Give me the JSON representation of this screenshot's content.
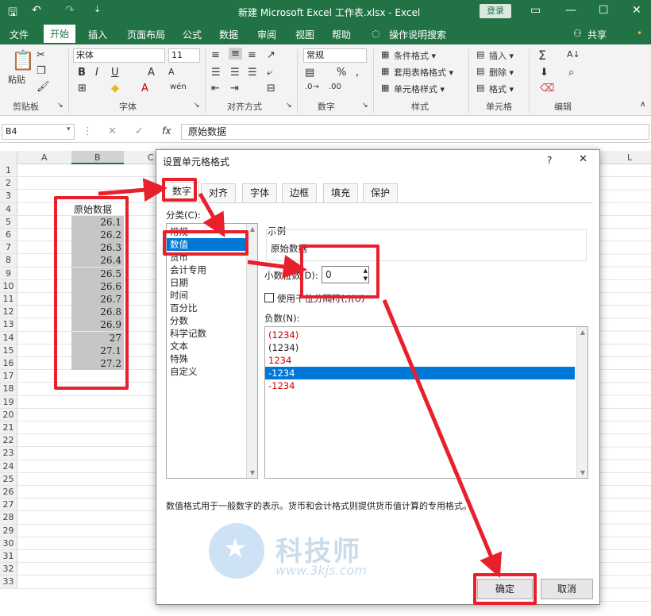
{
  "window": {
    "title": "新建 Microsoft Excel 工作表.xlsx  -  Excel",
    "login_label": "登录"
  },
  "menu": {
    "tabs": [
      "文件",
      "开始",
      "插入",
      "页面布局",
      "公式",
      "数据",
      "审阅",
      "视图",
      "帮助"
    ],
    "tell_me": "操作说明搜索",
    "share": "共享"
  },
  "ribbon": {
    "clipboard": {
      "paste": "粘贴",
      "group": "剪贴板"
    },
    "font": {
      "name": "宋体",
      "size": "11",
      "group": "字体"
    },
    "align": {
      "group": "对齐方式"
    },
    "number": {
      "format": "常规",
      "group": "数字"
    },
    "styles": {
      "cond": "条件格式 ▾",
      "table": "套用表格格式 ▾",
      "cell": "单元格样式 ▾",
      "group": "样式"
    },
    "cells": {
      "insert": "插入 ▾",
      "delete": "删除 ▾",
      "format": "格式 ▾",
      "group": "单元格"
    },
    "editing": {
      "group": "编辑"
    }
  },
  "formula_bar": {
    "name_box": "B4",
    "content": "原始数据"
  },
  "sheet": {
    "columns": [
      "A",
      "B",
      "C",
      "L"
    ],
    "rows": [
      "1",
      "2",
      "3",
      "4",
      "5",
      "6",
      "7",
      "8",
      "9",
      "10",
      "11",
      "12",
      "13",
      "14",
      "15",
      "16",
      "17",
      "18",
      "19",
      "20",
      "21",
      "22",
      "23",
      "24",
      "25",
      "26",
      "27",
      "28",
      "29",
      "30",
      "31",
      "32",
      "33"
    ],
    "header_cell": "原始数据",
    "values": [
      "26.1",
      "26.2",
      "26.3",
      "26.4",
      "26.5",
      "26.6",
      "26.7",
      "26.8",
      "26.9",
      "27",
      "27.1",
      "27.2"
    ]
  },
  "dialog": {
    "title": "设置单元格格式",
    "help": "?",
    "close": "✕",
    "tabs": [
      "数字",
      "对齐",
      "字体",
      "边框",
      "填充",
      "保护"
    ],
    "category_label": "分类(C):",
    "categories": [
      "常规",
      "数值",
      "货币",
      "会计专用",
      "日期",
      "时间",
      "百分比",
      "分数",
      "科学记数",
      "文本",
      "特殊",
      "自定义"
    ],
    "sample_label": "示例",
    "sample_value": "原始数据",
    "decimals_label": "小数位数(D):",
    "decimals_value": "0",
    "thousands_label": "使用千位分隔符(,)(U)",
    "negative_label": "负数(N):",
    "negatives": [
      "(1234)",
      "(1234)",
      "1234",
      "-1234",
      "-1234"
    ],
    "description": "数值格式用于一般数字的表示。货币和会计格式则提供货币值计算的专用格式。",
    "ok": "确定",
    "cancel": "取消"
  },
  "watermark": {
    "brand": "科技师",
    "url": "www.3kjs.com"
  },
  "colors": {
    "excel_green": "#217346",
    "highlight_red": "#e8202c",
    "selection_blue": "#0078d7"
  }
}
